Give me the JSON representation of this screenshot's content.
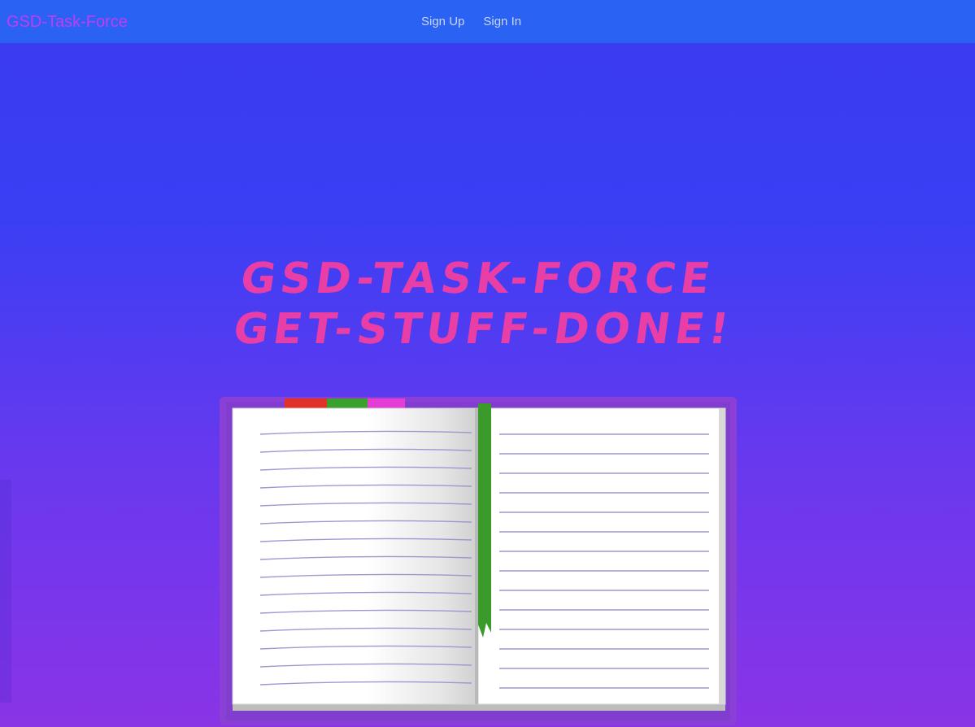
{
  "navbar": {
    "brand": "GSD-Task-Force",
    "links": [
      {
        "label": "Sign Up"
      },
      {
        "label": "Sign In"
      }
    ]
  },
  "hero": {
    "title_line1": "GSD-TASK-FORCE",
    "title_line2": "GET-STUFF-DONE!",
    "illustration": "open-notebook",
    "bookmark_tabs": [
      "red",
      "green",
      "magenta"
    ]
  },
  "colors": {
    "navbar_bg": "#2a62f3",
    "brand_text": "#c23cf0",
    "nav_link_text": "#c9d6f6",
    "headline": "#e83ea6",
    "background_top": "#3b3af0",
    "background_bottom": "#8a34e6",
    "bookmark_ribbon": "#3a9a2a"
  }
}
